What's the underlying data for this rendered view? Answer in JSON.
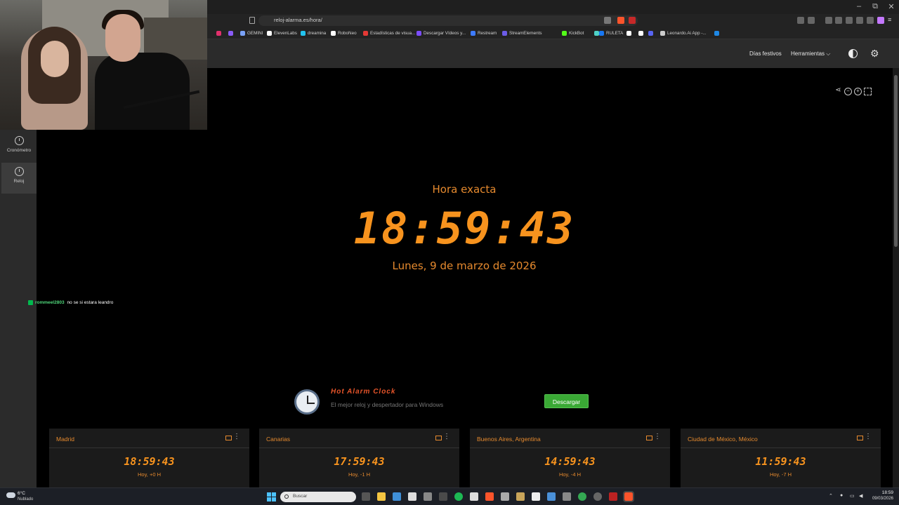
{
  "browser": {
    "url": "reloj-alarma.es/hora/",
    "window_controls": {
      "minimize": "–",
      "maximize": "⧉",
      "close": "✕"
    },
    "bookmarks": [
      {
        "label": "",
        "color": "#e1306c"
      },
      {
        "label": "",
        "color": "#8a5cf6"
      },
      {
        "label": "GEMINI",
        "color": "#7aa2f7"
      },
      {
        "label": "ElevenLabs",
        "color": "#ffffff"
      },
      {
        "label": "dreamina",
        "color": "#22c3ee"
      },
      {
        "label": "RoboNeo",
        "color": "#ffffff"
      },
      {
        "label": "Estadísticas de visua...",
        "color": "#e53935"
      },
      {
        "label": "Descargar Vídeos y...",
        "color": "#7c4dff"
      },
      {
        "label": "Restream",
        "color": "#3d7bff"
      },
      {
        "label": "StreamElements",
        "color": "#6c5ce7"
      },
      {
        "label": "KickBot",
        "color": "#53fc18"
      },
      {
        "label": "",
        "color": "#4fd1c5"
      },
      {
        "label": "RULETA",
        "color": "#1877f2"
      },
      {
        "label": "",
        "color": "#ffffff"
      },
      {
        "label": "",
        "color": "#ffffff"
      },
      {
        "label": "",
        "color": "#5865f2"
      },
      {
        "label": "Leonardo.Ai App -...",
        "color": "#cccccc"
      },
      {
        "label": "",
        "color": "#1e88e5"
      }
    ]
  },
  "site": {
    "nav": {
      "holidays": "Días festivos",
      "tools": "Herramientas ⌵"
    },
    "sidebar": [
      {
        "label": "Cronómetro",
        "active": false
      },
      {
        "label": "Reloj",
        "active": true
      }
    ],
    "main": {
      "title": "Hora exacta",
      "time": "18:59:43",
      "date": "Lunes, 9 de marzo de 2026"
    },
    "promo": {
      "title": "Hot Alarm Clock",
      "subtitle": "El mejor reloj y despertador para Windows",
      "button": "Descargar"
    },
    "cities": [
      {
        "name": "Madrid",
        "time": "18:59:43",
        "offset": "Hoy, +0 H"
      },
      {
        "name": "Canarias",
        "time": "17:59:43",
        "offset": "Hoy, -1 H"
      },
      {
        "name": "Buenos Aires, Argentina",
        "time": "14:59:43",
        "offset": "Hoy, -4 H"
      },
      {
        "name": "Ciudad de México, México",
        "time": "11:59:43",
        "offset": "Hoy, -7 H"
      }
    ]
  },
  "chat": {
    "user": "rommeel2803",
    "message": "no se si estara leandro"
  },
  "taskbar": {
    "weather_temp": "6°C",
    "weather_cond": "Nublado",
    "search_placeholder": "Buscar",
    "time": "18:59",
    "date": "09/03/2026"
  },
  "colors": {
    "accent": "#f7931e",
    "download_green": "#3aa935"
  }
}
